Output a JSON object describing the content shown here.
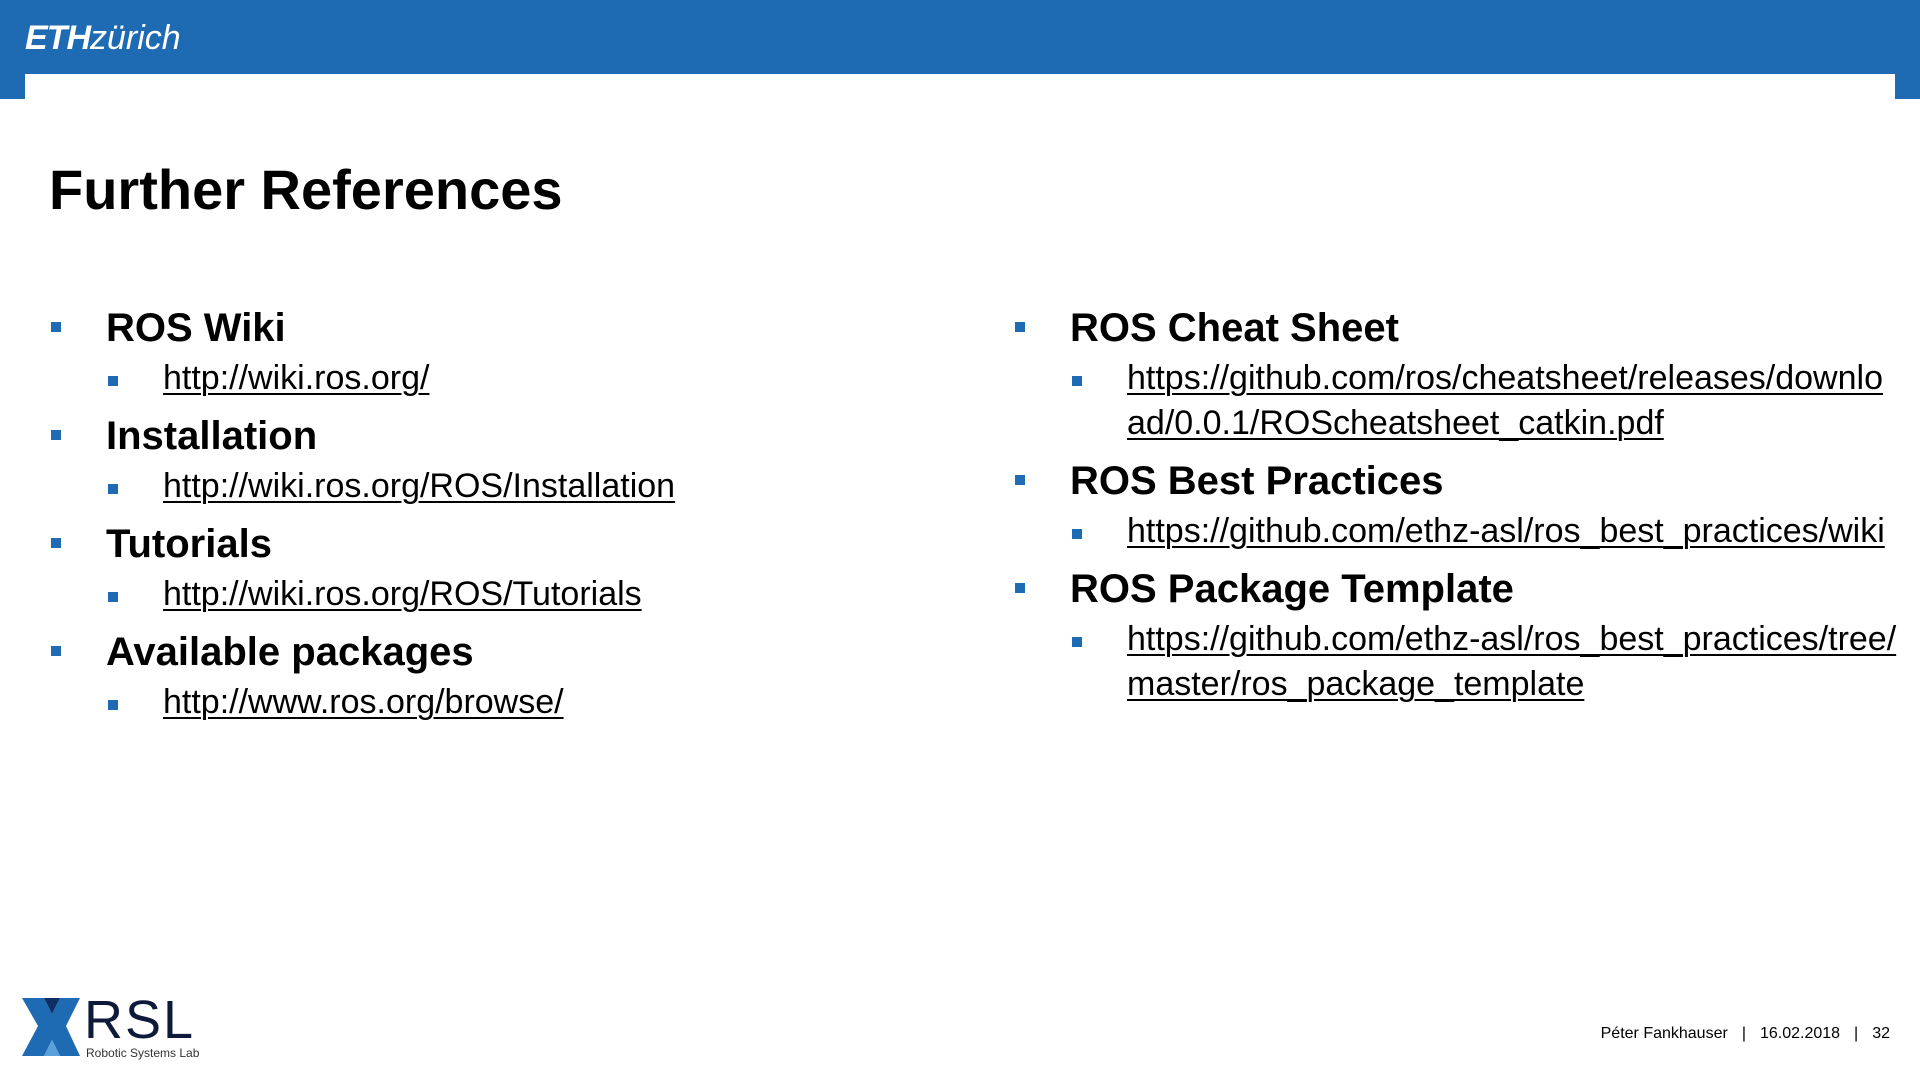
{
  "header": {
    "logo_eth": "ETH",
    "logo_zurich": "zürich"
  },
  "title": "Further References",
  "left_column": [
    {
      "label": "ROS Wiki",
      "links": [
        "http://wiki.ros.org/"
      ]
    },
    {
      "label": "Installation",
      "links": [
        "http://wiki.ros.org/ROS/Installation"
      ]
    },
    {
      "label": "Tutorials",
      "links": [
        "http://wiki.ros.org/ROS/Tutorials"
      ]
    },
    {
      "label": "Available packages",
      "links": [
        "http://www.ros.org/browse/"
      ]
    }
  ],
  "right_column": [
    {
      "label": "ROS Cheat Sheet",
      "links": [
        "https://github.com/ros/cheatsheet/releases/download/0.0.1/ROScheatsheet_catkin.pdf"
      ]
    },
    {
      "label": "ROS Best Practices",
      "links": [
        "https://github.com/ethz-asl/ros_best_practices/wiki"
      ]
    },
    {
      "label": "ROS Package Template",
      "links": [
        "https://github.com/ethz-asl/ros_best_practices/tree/master/ros_package_template"
      ]
    }
  ],
  "footer": {
    "logo_text": "RSL",
    "logo_subtitle": "Robotic Systems Lab",
    "author": "Péter Fankhauser",
    "date": "16.02.2018",
    "page_number": "32"
  },
  "colors": {
    "accent": "#1f6bb3",
    "text": "#000000",
    "background": "#ffffff"
  }
}
